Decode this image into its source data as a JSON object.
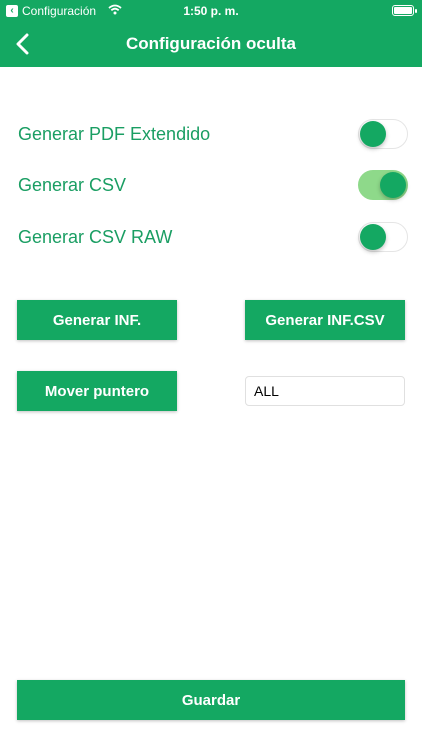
{
  "status_bar": {
    "back_app": "Configuración",
    "time": "1:50 p. m."
  },
  "nav": {
    "title": "Configuración oculta"
  },
  "settings": [
    {
      "label": "Generar PDF Extendido",
      "enabled": false
    },
    {
      "label": "Generar CSV",
      "enabled": true
    },
    {
      "label": "Generar CSV RAW",
      "enabled": false
    }
  ],
  "actions": {
    "generate_inf": "Generar INF.",
    "generate_inf_csv": "Generar INF.CSV",
    "move_pointer": "Mover puntero",
    "pointer_value": "ALL",
    "save": "Guardar"
  },
  "colors": {
    "primary": "#14a862",
    "label_green": "#1a9e63",
    "toggle_on_track": "#8ed98a"
  }
}
